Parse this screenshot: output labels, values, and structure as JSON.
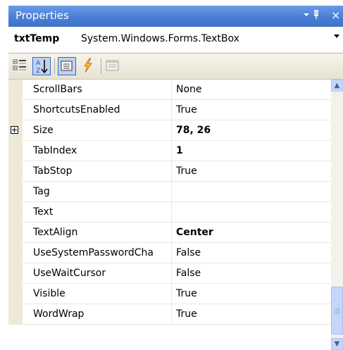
{
  "panel": {
    "title": "Properties",
    "pin_glyph": "▾ ᛘ",
    "close_glyph": "×"
  },
  "object": {
    "name": "txtTemp",
    "type": "System.Windows.Forms.TextBox"
  },
  "toolbar": [
    "categorized-icon",
    "alphabetical-icon",
    "properties-icon",
    "events-icon",
    "property-pages-icon"
  ],
  "rows": [
    {
      "name": "ScrollBars",
      "value": "None",
      "bold": false,
      "expandable": false
    },
    {
      "name": "ShortcutsEnabled",
      "value": "True",
      "bold": false,
      "expandable": false
    },
    {
      "name": "Size",
      "value": "78, 26",
      "bold": true,
      "expandable": true
    },
    {
      "name": "TabIndex",
      "value": "1",
      "bold": true,
      "expandable": false
    },
    {
      "name": "TabStop",
      "value": "True",
      "bold": false,
      "expandable": false
    },
    {
      "name": "Tag",
      "value": "",
      "bold": false,
      "expandable": false
    },
    {
      "name": "Text",
      "value": "",
      "bold": false,
      "expandable": false
    },
    {
      "name": "TextAlign",
      "value": "Center",
      "bold": true,
      "expandable": false
    },
    {
      "name": "UseSystemPasswordCha",
      "value": "False",
      "bold": false,
      "expandable": false
    },
    {
      "name": "UseWaitCursor",
      "value": "False",
      "bold": false,
      "expandable": false
    },
    {
      "name": "Visible",
      "value": "True",
      "bold": false,
      "expandable": false
    },
    {
      "name": "WordWrap",
      "value": "True",
      "bold": false,
      "expandable": false
    }
  ],
  "colors": {
    "accent": "#3169c6",
    "title_bar": "#4a7ed6",
    "gutter": "#ece9d8"
  }
}
